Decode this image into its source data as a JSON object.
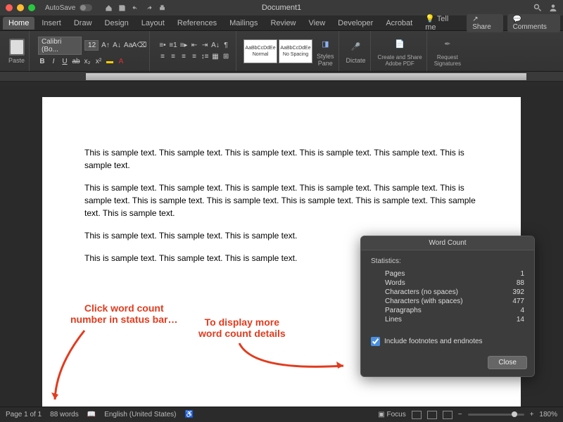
{
  "titlebar": {
    "autosave_label": "AutoSave",
    "document_name": "Document1"
  },
  "tabs": {
    "items": [
      {
        "label": "Home"
      },
      {
        "label": "Insert"
      },
      {
        "label": "Draw"
      },
      {
        "label": "Design"
      },
      {
        "label": "Layout"
      },
      {
        "label": "References"
      },
      {
        "label": "Mailings"
      },
      {
        "label": "Review"
      },
      {
        "label": "View"
      },
      {
        "label": "Developer"
      },
      {
        "label": "Acrobat"
      }
    ],
    "tell_me": "Tell me",
    "share": "Share",
    "comments": "Comments"
  },
  "ribbon": {
    "paste": "Paste",
    "font_name": "Calibri (Bo...",
    "font_size": "12",
    "styles": {
      "normal_sample": "AaBbCcDdEe",
      "normal_label": "Normal",
      "nospacing_sample": "AaBbCcDdEe",
      "nospacing_label": "No Spacing",
      "pane": "Styles\nPane"
    },
    "dictate": "Dictate",
    "adobe": "Create and Share\nAdobe PDF",
    "signatures": "Request\nSignatures"
  },
  "document": {
    "p1": "This is sample text. This sample text. This is sample text. This is sample text. This sample text. This is sample text.",
    "p2": "This is sample text. This sample text. This is sample text. This is sample text. This sample text. This is sample text. This is sample text. This is sample text. This is sample text. This is sample text. This sample text. This is sample text.",
    "p3": "This is sample text. This sample text. This is sample text.",
    "p4": "This is sample text. This sample text. This is sample text."
  },
  "annotations": {
    "left_line1": "Click word count",
    "left_line2": "number in status bar…",
    "right_line1": "To display more",
    "right_line2": "word count details"
  },
  "dialog": {
    "title": "Word Count",
    "statistics_label": "Statistics:",
    "rows": [
      {
        "label": "Pages",
        "value": "1"
      },
      {
        "label": "Words",
        "value": "88"
      },
      {
        "label": "Characters (no spaces)",
        "value": "392"
      },
      {
        "label": "Characters (with spaces)",
        "value": "477"
      },
      {
        "label": "Paragraphs",
        "value": "4"
      },
      {
        "label": "Lines",
        "value": "14"
      }
    ],
    "include_label": "Include footnotes and endnotes",
    "close": "Close"
  },
  "status": {
    "page": "Page 1 of 1",
    "words": "88 words",
    "language": "English (United States)",
    "focus": "Focus",
    "zoom": "180%"
  }
}
